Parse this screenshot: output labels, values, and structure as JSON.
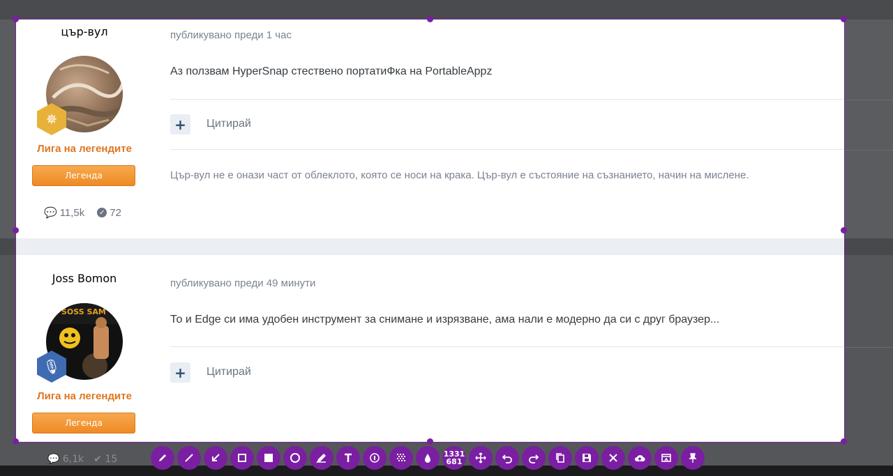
{
  "posts": [
    {
      "author": "цър-вул",
      "group": "Лига на легендите",
      "rank": "Легенда",
      "posts_count": "11,5k",
      "reputation": "72",
      "meta": "публикувано преди 1 час",
      "content": "Аз ползвам HyperSnap стествено портатиФка на PortableAppz",
      "quote_label": "Цитирай",
      "signature": "Цър-вул не е онази част от облеклото, която се носи на крака. Цър-вул е състояние на съзнанието, начин на мислене."
    },
    {
      "author": "Joss Bomon",
      "group": "Лига на легендите",
      "rank": "Легенда",
      "posts_count": "6,1k",
      "reputation": "15",
      "meta": "публикувано преди 49 минути",
      "content": "То и Edge си има удобен инструмент за снимане и изрязване, ама нали е модерно да си с друг браузер...",
      "quote_label": "Цитирай"
    }
  ],
  "avatar2_text": "SOSS SAM",
  "toolbar": {
    "size_w": "1331",
    "size_h": "681",
    "tools": [
      "pen-icon",
      "line-icon",
      "arrow-icon",
      "rect-icon",
      "filled-rect-icon",
      "ellipse-icon",
      "marker-icon",
      "text-icon",
      "counter-icon",
      "pixelate-icon",
      "blur-icon",
      "size-readout",
      "move-icon",
      "undo-icon",
      "redo-icon",
      "copy-icon",
      "save-icon",
      "close-icon",
      "upload-icon",
      "open-app-icon",
      "pin-icon"
    ]
  },
  "colors": {
    "accent": "#7a1fa2",
    "group": "#e0761f",
    "rank": "#ee8a25"
  }
}
